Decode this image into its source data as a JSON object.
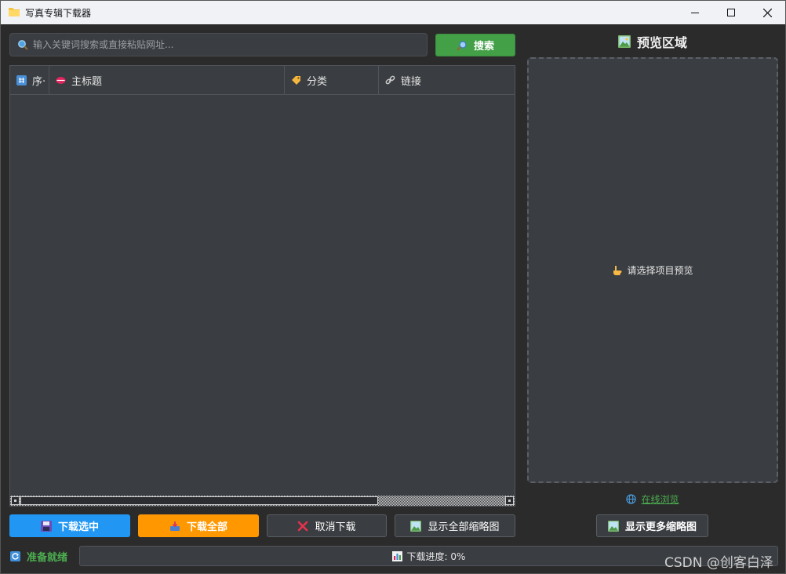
{
  "window": {
    "title": "写真专辑下载器"
  },
  "search": {
    "placeholder": "输入关键词搜索或直接粘贴网址...",
    "value": "",
    "button_label": "搜索"
  },
  "table": {
    "columns": [
      {
        "label": "序·",
        "icon": "hash-icon"
      },
      {
        "label": "主标题",
        "icon": "lips-icon"
      },
      {
        "label": "分类",
        "icon": "tag-icon"
      },
      {
        "label": "链接",
        "icon": "link-icon"
      }
    ],
    "rows": []
  },
  "preview": {
    "title": "预览区域",
    "hint": "请选择项目预览",
    "online_link": "在线浏览"
  },
  "buttons": {
    "download_selected": "下载选中",
    "download_all": "下载全部",
    "cancel_download": "取消下载",
    "show_all_thumbnails": "显示全部缩略图",
    "show_more_thumbnails": "显示更多缩略图"
  },
  "status": {
    "text": "准备就绪",
    "progress_label": "下载进度: 0%",
    "progress_fraction": 0
  },
  "watermark": "CSDN @创客白泽",
  "colors": {
    "accent_green": "#43a047",
    "accent_blue": "#2196f3",
    "accent_orange": "#ff9800",
    "background": "#2b2b2b",
    "panel": "#3a3d41"
  }
}
